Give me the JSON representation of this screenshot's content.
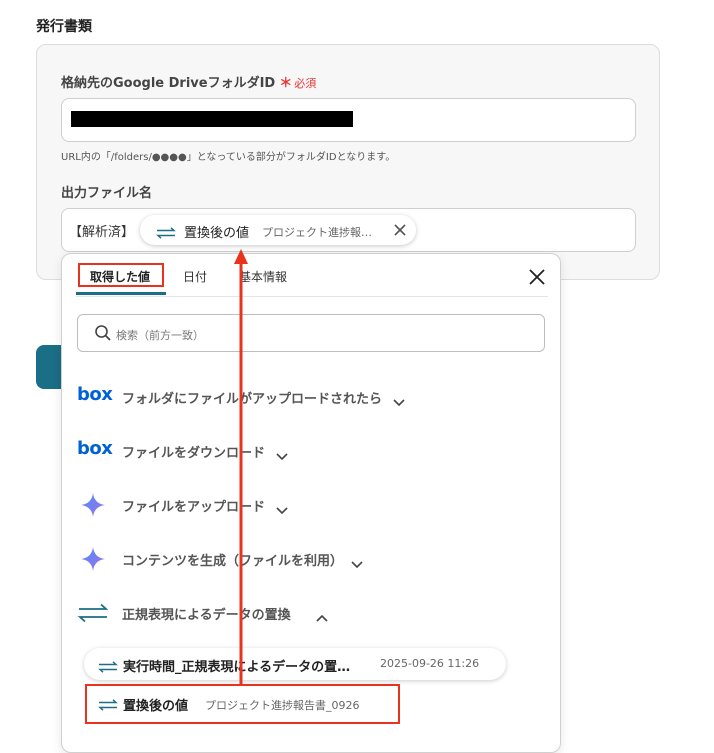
{
  "section": {
    "title": "発行書類"
  },
  "folder_field": {
    "label": "格納先のGoogle DriveフォルダID",
    "required_mark": "＊",
    "required_text": "必須",
    "hint": "URL内の「/folders/●●●●」となっている部分がフォルダIDとなります。"
  },
  "filename_field": {
    "label": "出力ファイル名",
    "prefix": "【解析済】",
    "chip": {
      "title": "置換後の値",
      "subtitle": "プロジェクト進捗報…",
      "icon": "replace-arrows-icon"
    }
  },
  "dropdown": {
    "tabs": [
      {
        "label": "取得した値",
        "active": true
      },
      {
        "label": "日付",
        "active": false
      },
      {
        "label": "基本情報",
        "active": false
      }
    ],
    "search_placeholder": "検索（前方一致）",
    "items": [
      {
        "label": "フォルダにファイルがアップロードされたら",
        "icon": "box-logo",
        "logo_text": "box"
      },
      {
        "label": "ファイルをダウンロード",
        "icon": "box-logo",
        "logo_text": "box"
      },
      {
        "label": "ファイルをアップロード",
        "icon": "gemini-sparkle-icon"
      },
      {
        "label": "コンテンツを生成（ファイルを利用）",
        "icon": "gemini-sparkle-icon"
      },
      {
        "label": "正規表現によるデータの置換",
        "icon": "replace-arrows-icon",
        "expanded": true
      }
    ],
    "sub_items": [
      {
        "title": "実行時間_正規表現によるデータの置…",
        "meta": "2025-09-26 11:26"
      },
      {
        "title": "置換後の値",
        "meta": "プロジェクト進捗報告書_0926"
      }
    ]
  },
  "colors": {
    "accent": "#1a6e85",
    "highlight": "#e8341c",
    "box_blue": "#0061d5",
    "required": "#e53935"
  }
}
